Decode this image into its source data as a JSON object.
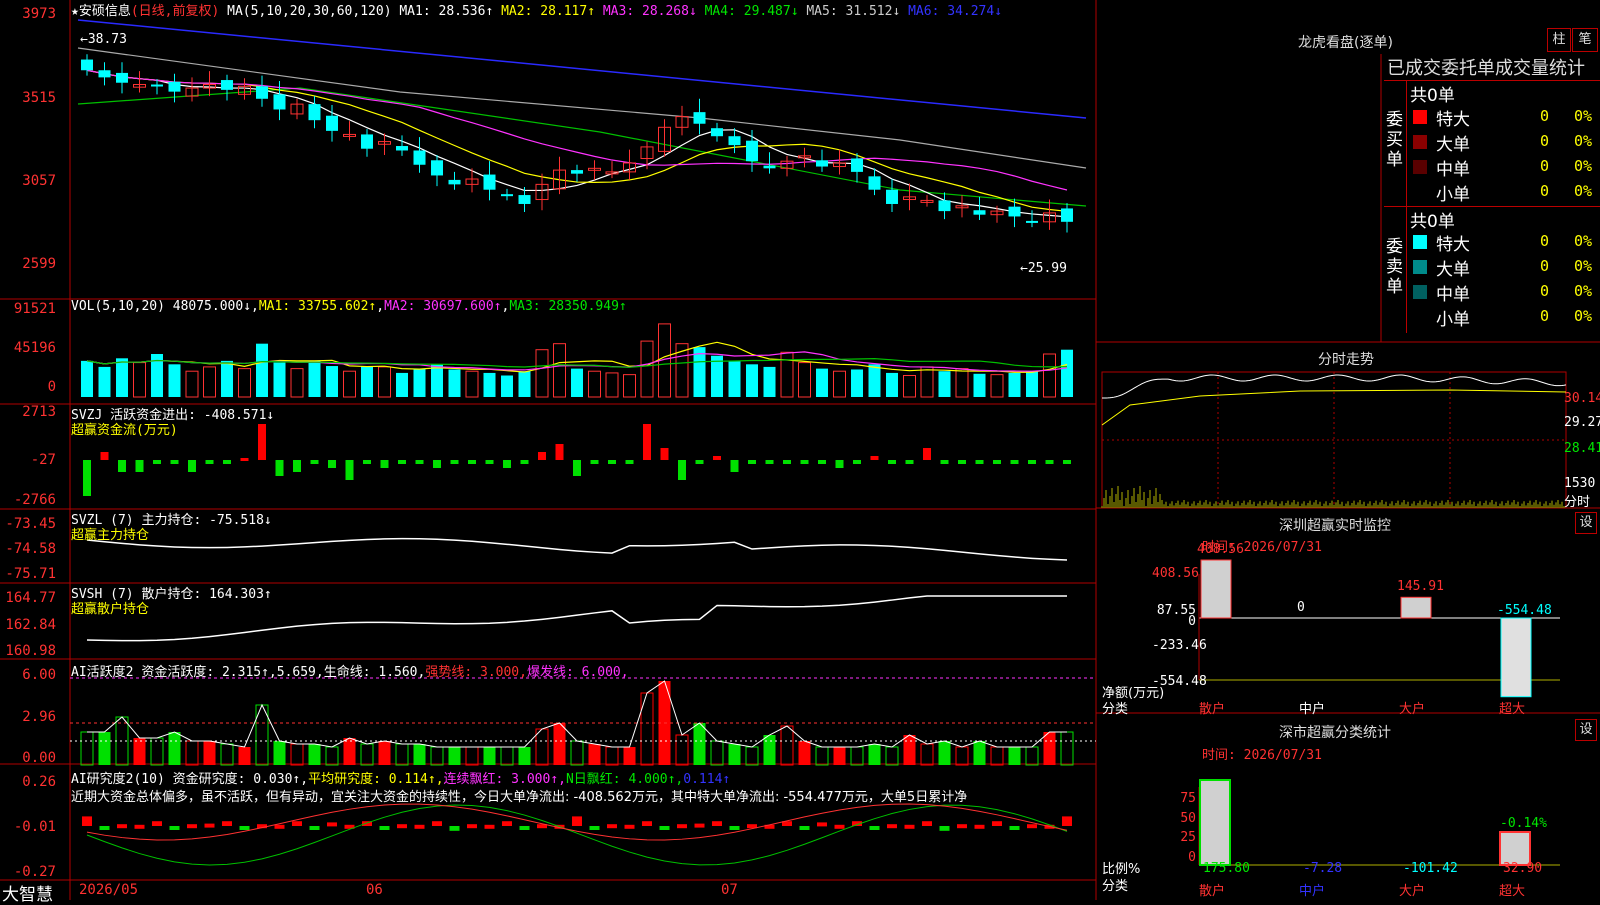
{
  "stock": {
    "star": "★",
    "name": "安硕信息",
    "mode": "(日线,前复权)"
  },
  "main_ma": {
    "label": "MA(5,10,20,30,60,120)",
    "ma1": "MA1: 28.536↑",
    "ma2": "MA2: 28.117↑",
    "ma3": "MA3: 28.268↓",
    "ma4": "MA4: 29.487↓",
    "ma5": "MA5: 31.512↓",
    "ma6": "MA6: 34.274↓"
  },
  "main_axis": [
    "3973",
    "3515",
    "3057",
    "2599"
  ],
  "price_marks": {
    "high": "38.73",
    "low": "25.99"
  },
  "vol": {
    "label": "VOL(5,10,20)",
    "v": "48075.000↓",
    "ma1": "MA1: 33755.602↑",
    "ma2": "MA2: 30697.600↑",
    "ma3": "MA3: 28350.949↑",
    "axis": [
      "91521",
      "45196",
      "0"
    ]
  },
  "svzj": {
    "label": "SVZJ",
    "desc": "活跃资金进出: -408.571↓",
    "sub": "超赢资金流(万元)",
    "axis": [
      "2713",
      "-27",
      "-2766"
    ]
  },
  "svzl": {
    "label": "SVZL (7)",
    "desc": "主力持仓: -75.518↓",
    "sub": "超赢主力持仓",
    "axis": [
      "-73.45",
      "-74.58",
      "-75.71"
    ]
  },
  "svsh": {
    "label": "SVSH (7)",
    "desc": "散户持仓: 164.303↑",
    "sub": "超赢散户持仓",
    "axis": [
      "164.77",
      "162.84",
      "160.98"
    ]
  },
  "ai1": {
    "label": "AI活跃度2",
    "p1": "资金活跃度: 2.315↑,5.659,",
    "p2": "生命线: 1.560,",
    "p3": "强势线: 3.000,",
    "p4": "爆发线: 6.000,",
    "axis": [
      "6.00",
      "2.96",
      "0.00"
    ]
  },
  "ai2": {
    "label": "AI研究度2(10)",
    "p1": "资金研究度: 0.030↑,",
    "p2": "平均研究度: 0.114↑,",
    "p3": "连续飘红: 3.000↑,",
    "p4": "N日飘红: 4.000↑,",
    "p5": "0.114↑",
    "comment": "近期大资金总体偏多，虽不活跃，但有异动，宜关注大资金的持续性，今日大单净流出: -408.562万元，其中特大单净流出: -554.477万元，大单5日累计净",
    "axis": [
      "0.26",
      "-0.01",
      "-0.27"
    ]
  },
  "bottom": {
    "brand": "大智慧",
    "dates": [
      "2026/05",
      "06",
      "07"
    ]
  },
  "lhb": {
    "title": "龙虎看盘(逐单)",
    "btn1": "柱",
    "btn2": "笔",
    "header": "已成交委托单成交量统计",
    "buy_label": "委买单",
    "sell_label": "委卖单",
    "buy_total": "共0单",
    "sell_total": "共0单",
    "buy_rows": [
      {
        "name": "特大",
        "n": "0",
        "p": "0%",
        "c": "#ff0000"
      },
      {
        "name": "大单",
        "n": "0",
        "p": "0%",
        "c": "#8b0000"
      },
      {
        "name": "中单",
        "n": "0",
        "p": "0%",
        "c": "#5a0000"
      },
      {
        "name": "小单",
        "n": "0",
        "p": "0%",
        "c": "#000000"
      }
    ],
    "sell_rows": [
      {
        "name": "特大",
        "n": "0",
        "p": "0%",
        "c": "#00ffff"
      },
      {
        "name": "大单",
        "n": "0",
        "p": "0%",
        "c": "#008b8b"
      },
      {
        "name": "中单",
        "n": "0",
        "p": "0%",
        "c": "#006060"
      },
      {
        "name": "小单",
        "n": "0",
        "p": "0%",
        "c": "#000000"
      }
    ]
  },
  "fenshi": {
    "title": "分时走势",
    "axis": [
      "30.14",
      "29.27",
      "28.41"
    ],
    "vol": "1530",
    "vol_unit": "分时"
  },
  "monitor": {
    "title": "深圳超赢实时监控",
    "btn": "设",
    "time": "时间: 2026/07/31",
    "axis": [
      "408.56",
      "87.55",
      "0",
      "-233.46",
      "-554.48"
    ],
    "unit1": "净额(万元)",
    "unit2": "分类",
    "bars": [
      {
        "cat": "散户",
        "val": "408.56",
        "v": 408.56
      },
      {
        "cat": "中户",
        "val": "0",
        "v": 0
      },
      {
        "cat": "大户",
        "val": "145.91",
        "v": 145.91
      },
      {
        "cat": "超大",
        "val": "-554.48",
        "v": -554.48
      }
    ]
  },
  "cls": {
    "title": "深市超赢分类统计",
    "btn": "设",
    "time": "时间: 2026/07/31",
    "axis": [
      "75",
      "50",
      "25",
      "0"
    ],
    "unit1": "比例%",
    "unit2": "分类",
    "bars": [
      {
        "cat": "散户",
        "val": "175.80"
      },
      {
        "cat": "中户",
        "val": "-7.28"
      },
      {
        "cat": "大户",
        "val": "-101.42"
      },
      {
        "cat": "超大",
        "val": "32.90"
      }
    ],
    "pct": "-0.14%"
  },
  "colors": {
    "up": "#ff3232",
    "down": "#00ffff",
    "grid": "#b00000"
  }
}
